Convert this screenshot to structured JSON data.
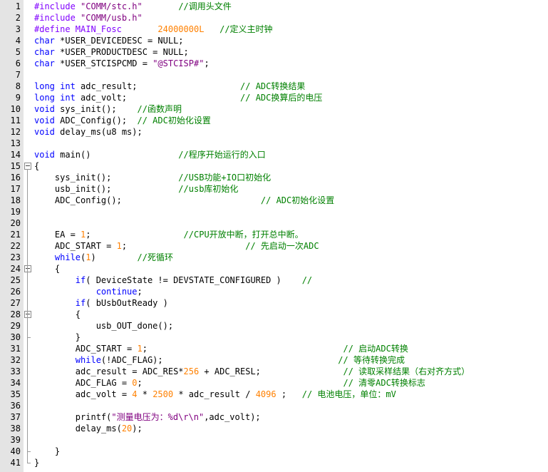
{
  "theme": {
    "keyword_color": "#0000ff",
    "preprocessor_color": "#8000ff",
    "string_color": "#800080",
    "number_color": "#ff8000",
    "comment_color": "#008000",
    "gutter_color": "#e4e4e4"
  },
  "lines": [
    {
      "num": "1",
      "segs": [
        {
          "t": "#include ",
          "c": "pp"
        },
        {
          "t": "\"COMM/stc.h\"",
          "c": "str"
        },
        {
          "t": "       ",
          "c": "pl"
        },
        {
          "t": "//调用头文件",
          "c": "cm"
        }
      ]
    },
    {
      "num": "2",
      "segs": [
        {
          "t": "#include ",
          "c": "pp"
        },
        {
          "t": "\"COMM/usb.h\"",
          "c": "str"
        }
      ]
    },
    {
      "num": "3",
      "segs": [
        {
          "t": "#define MAIN_Fosc       ",
          "c": "pp"
        },
        {
          "t": "24000000L",
          "c": "num"
        },
        {
          "t": "   ",
          "c": "pl"
        },
        {
          "t": "//定义主时钟",
          "c": "cm"
        }
      ]
    },
    {
      "num": "4",
      "segs": [
        {
          "t": "char",
          "c": "kw"
        },
        {
          "t": " *USER_DEVICEDESC = NULL;",
          "c": "pl"
        }
      ]
    },
    {
      "num": "5",
      "segs": [
        {
          "t": "char",
          "c": "kw"
        },
        {
          "t": " *USER_PRODUCTDESC = NULL;",
          "c": "pl"
        }
      ]
    },
    {
      "num": "6",
      "segs": [
        {
          "t": "char",
          "c": "kw"
        },
        {
          "t": " *USER_STCISPCMD = ",
          "c": "pl"
        },
        {
          "t": "\"@STCISP#\"",
          "c": "str"
        },
        {
          "t": ";",
          "c": "pl"
        }
      ]
    },
    {
      "num": "7",
      "segs": []
    },
    {
      "num": "8",
      "segs": [
        {
          "t": "long",
          "c": "kw"
        },
        {
          "t": " ",
          "c": "pl"
        },
        {
          "t": "int",
          "c": "kw"
        },
        {
          "t": " adc_result;                    ",
          "c": "pl"
        },
        {
          "t": "// ADC转换结果",
          "c": "cm"
        }
      ]
    },
    {
      "num": "9",
      "segs": [
        {
          "t": "long",
          "c": "kw"
        },
        {
          "t": " ",
          "c": "pl"
        },
        {
          "t": "int",
          "c": "kw"
        },
        {
          "t": " adc_volt;                      ",
          "c": "pl"
        },
        {
          "t": "// ADC换算后的电压",
          "c": "cm"
        }
      ]
    },
    {
      "num": "10",
      "segs": [
        {
          "t": "void",
          "c": "kw"
        },
        {
          "t": " sys_init();    ",
          "c": "pl"
        },
        {
          "t": "//函数声明",
          "c": "cm"
        }
      ]
    },
    {
      "num": "11",
      "segs": [
        {
          "t": "void",
          "c": "kw"
        },
        {
          "t": " ADC_Config();  ",
          "c": "pl"
        },
        {
          "t": "// ADC初始化设置",
          "c": "cm"
        }
      ]
    },
    {
      "num": "12",
      "segs": [
        {
          "t": "void",
          "c": "kw"
        },
        {
          "t": " delay_ms(u8 ms);",
          "c": "pl"
        }
      ]
    },
    {
      "num": "13",
      "segs": []
    },
    {
      "num": "14",
      "segs": [
        {
          "t": "void",
          "c": "kw"
        },
        {
          "t": " main()                 ",
          "c": "pl"
        },
        {
          "t": "//程序开始运行的入口",
          "c": "cm"
        }
      ]
    },
    {
      "num": "15",
      "segs": [
        {
          "t": "{",
          "c": "pl"
        }
      ]
    },
    {
      "num": "16",
      "segs": [
        {
          "t": "    sys_init();             ",
          "c": "pl"
        },
        {
          "t": "//USB功能+IO口初始化",
          "c": "cm"
        }
      ]
    },
    {
      "num": "17",
      "segs": [
        {
          "t": "    usb_init();             ",
          "c": "pl"
        },
        {
          "t": "//usb库初始化",
          "c": "cm"
        }
      ]
    },
    {
      "num": "18",
      "segs": [
        {
          "t": "    ADC_Config();                           ",
          "c": "pl"
        },
        {
          "t": "// ADC初始化设置",
          "c": "cm"
        }
      ]
    },
    {
      "num": "19",
      "segs": []
    },
    {
      "num": "20",
      "segs": []
    },
    {
      "num": "21",
      "segs": [
        {
          "t": "    EA = ",
          "c": "pl"
        },
        {
          "t": "1",
          "c": "num"
        },
        {
          "t": ";                  ",
          "c": "pl"
        },
        {
          "t": "//CPU开放中断，打开总中断。",
          "c": "cm"
        }
      ]
    },
    {
      "num": "22",
      "segs": [
        {
          "t": "    ADC_START = ",
          "c": "pl"
        },
        {
          "t": "1",
          "c": "num"
        },
        {
          "t": ";                       ",
          "c": "pl"
        },
        {
          "t": "// 先启动一次ADC",
          "c": "cm"
        }
      ]
    },
    {
      "num": "23",
      "segs": [
        {
          "t": "    ",
          "c": "pl"
        },
        {
          "t": "while",
          "c": "kw"
        },
        {
          "t": "(",
          "c": "pl"
        },
        {
          "t": "1",
          "c": "num"
        },
        {
          "t": ")        ",
          "c": "pl"
        },
        {
          "t": "//死循环",
          "c": "cm"
        }
      ]
    },
    {
      "num": "24",
      "segs": [
        {
          "t": "    {",
          "c": "pl"
        }
      ]
    },
    {
      "num": "25",
      "segs": [
        {
          "t": "        ",
          "c": "pl"
        },
        {
          "t": "if",
          "c": "kw"
        },
        {
          "t": "( DeviceState != DEVSTATE_CONFIGURED )    ",
          "c": "pl"
        },
        {
          "t": "//",
          "c": "cm"
        }
      ]
    },
    {
      "num": "26",
      "segs": [
        {
          "t": "            ",
          "c": "pl"
        },
        {
          "t": "continue",
          "c": "kw"
        },
        {
          "t": ";",
          "c": "pl"
        }
      ]
    },
    {
      "num": "27",
      "segs": [
        {
          "t": "        ",
          "c": "pl"
        },
        {
          "t": "if",
          "c": "kw"
        },
        {
          "t": "( bUsbOutReady )",
          "c": "pl"
        }
      ]
    },
    {
      "num": "28",
      "segs": [
        {
          "t": "        {",
          "c": "pl"
        }
      ]
    },
    {
      "num": "29",
      "segs": [
        {
          "t": "            usb_OUT_done();",
          "c": "pl"
        }
      ]
    },
    {
      "num": "30",
      "segs": [
        {
          "t": "        }",
          "c": "pl"
        }
      ]
    },
    {
      "num": "31",
      "segs": [
        {
          "t": "        ADC_START = ",
          "c": "pl"
        },
        {
          "t": "1",
          "c": "num"
        },
        {
          "t": ";                                      ",
          "c": "pl"
        },
        {
          "t": "// 启动ADC转换",
          "c": "cm"
        }
      ]
    },
    {
      "num": "32",
      "segs": [
        {
          "t": "        ",
          "c": "pl"
        },
        {
          "t": "while",
          "c": "kw"
        },
        {
          "t": "(!ADC_FLAG);                                  ",
          "c": "pl"
        },
        {
          "t": "// 等待转换完成",
          "c": "cm"
        }
      ]
    },
    {
      "num": "33",
      "segs": [
        {
          "t": "        adc_result = ADC_RES*",
          "c": "pl"
        },
        {
          "t": "256",
          "c": "num"
        },
        {
          "t": " + ADC_RESL;                ",
          "c": "pl"
        },
        {
          "t": "// 读取采样结果（右对齐方式）",
          "c": "cm"
        }
      ]
    },
    {
      "num": "34",
      "segs": [
        {
          "t": "        ADC_FLAG = ",
          "c": "pl"
        },
        {
          "t": "0",
          "c": "num"
        },
        {
          "t": ";                                       ",
          "c": "pl"
        },
        {
          "t": "// 清零ADC转换标志",
          "c": "cm"
        }
      ]
    },
    {
      "num": "35",
      "segs": [
        {
          "t": "        adc_volt = ",
          "c": "pl"
        },
        {
          "t": "4",
          "c": "num"
        },
        {
          "t": " * ",
          "c": "pl"
        },
        {
          "t": "2500",
          "c": "num"
        },
        {
          "t": " * adc_result / ",
          "c": "pl"
        },
        {
          "t": "4096",
          "c": "num"
        },
        {
          "t": " ;   ",
          "c": "pl"
        },
        {
          "t": "// 电池电压，单位：mV",
          "c": "cm"
        }
      ]
    },
    {
      "num": "36",
      "segs": []
    },
    {
      "num": "37",
      "segs": [
        {
          "t": "        printf(",
          "c": "pl"
        },
        {
          "t": "\"测量电压为：%d\\r\\n\"",
          "c": "str"
        },
        {
          "t": ",adc_volt);",
          "c": "pl"
        }
      ]
    },
    {
      "num": "38",
      "segs": [
        {
          "t": "        delay_ms(",
          "c": "pl"
        },
        {
          "t": "20",
          "c": "num"
        },
        {
          "t": ");",
          "c": "pl"
        }
      ]
    },
    {
      "num": "39",
      "segs": []
    },
    {
      "num": "40",
      "segs": [
        {
          "t": "    }",
          "c": "pl"
        }
      ]
    },
    {
      "num": "41",
      "segs": [
        {
          "t": "}",
          "c": "pl"
        }
      ]
    }
  ],
  "folds": [
    {
      "line": "15",
      "kind": "open"
    },
    {
      "line": "24",
      "kind": "open"
    },
    {
      "line": "28",
      "kind": "open"
    }
  ]
}
